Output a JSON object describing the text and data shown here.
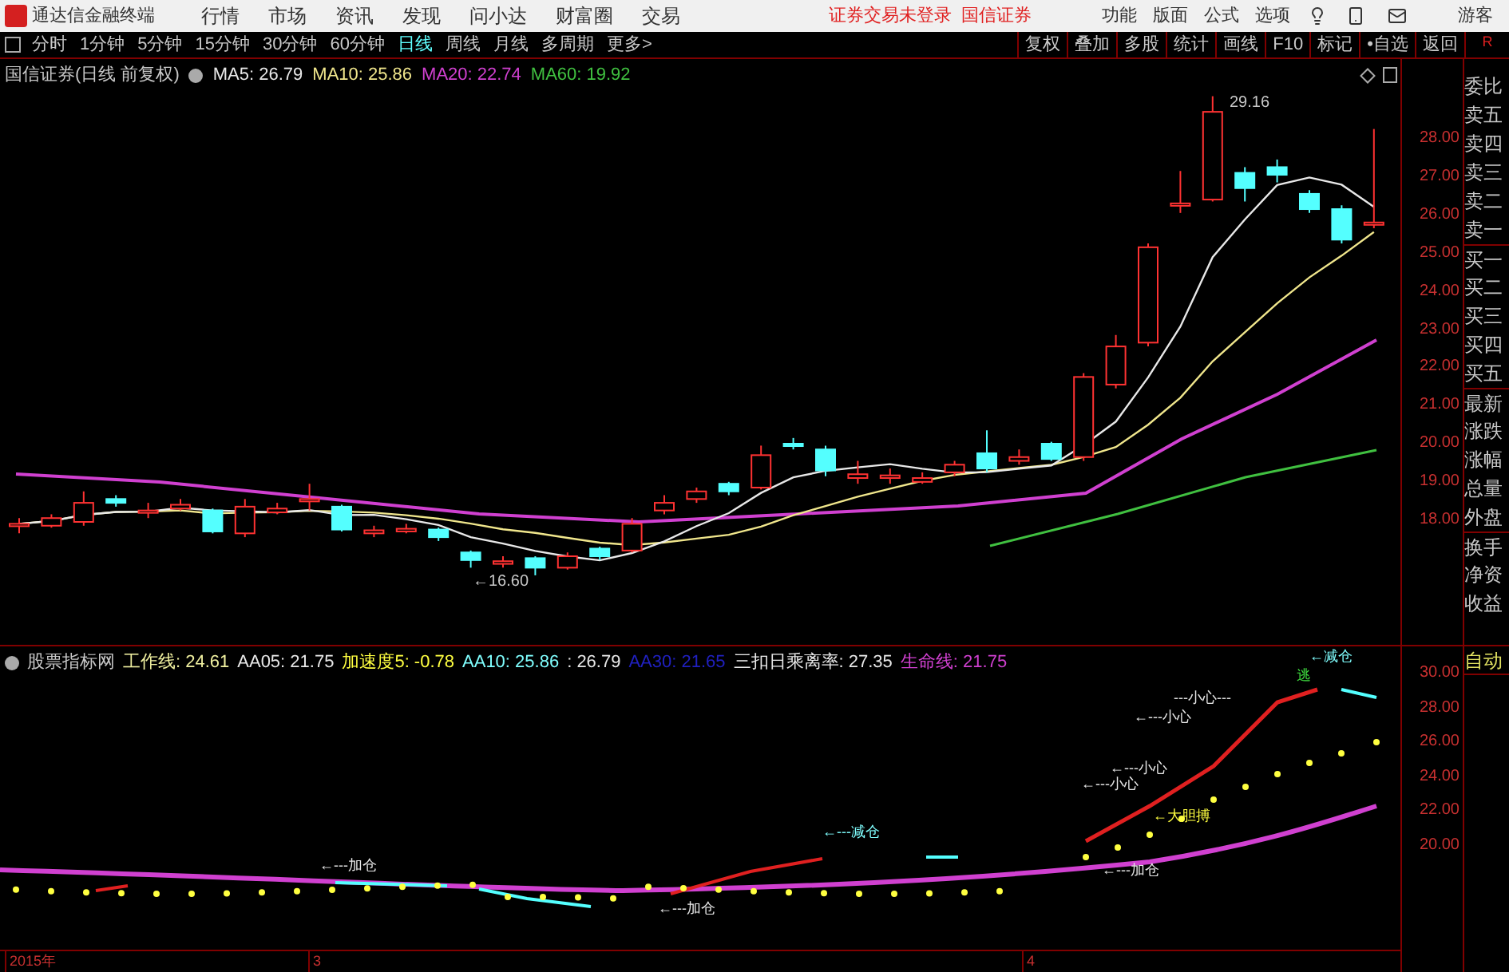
{
  "title_bar": {
    "app_name": "通达信金融终端",
    "menus": [
      "行情",
      "市场",
      "资讯",
      "发现",
      "问小达",
      "财富圈",
      "交易"
    ],
    "status_texts": [
      "证券交易未登录",
      "国信证券"
    ],
    "tools": [
      "功能",
      "版面",
      "公式",
      "选项"
    ],
    "user": "游客"
  },
  "period_bar": {
    "periods": [
      {
        "label": "分时",
        "selected": false
      },
      {
        "label": "1分钟",
        "selected": false
      },
      {
        "label": "5分钟",
        "selected": false
      },
      {
        "label": "15分钟",
        "selected": false
      },
      {
        "label": "30分钟",
        "selected": false
      },
      {
        "label": "60分钟",
        "selected": false
      },
      {
        "label": "日线",
        "selected": true
      },
      {
        "label": "周线",
        "selected": false
      },
      {
        "label": "月线",
        "selected": false
      },
      {
        "label": "多周期",
        "selected": false
      },
      {
        "label": "更多>",
        "selected": false
      }
    ],
    "actions": [
      "复权",
      "叠加",
      "多股",
      "统计",
      "画线",
      "F10",
      "标记",
      "•自选",
      "返回"
    ],
    "corner": "R"
  },
  "main_chart": {
    "title": "国信证券(日线 前复权)",
    "ma": [
      {
        "label": "MA5: 26.79",
        "color": "#e8e8e8"
      },
      {
        "label": "MA10: 25.86",
        "color": "#f0e68c"
      },
      {
        "label": "MA20: 22.74",
        "color": "#d040d0"
      },
      {
        "label": "MA60: 19.92",
        "color": "#40c040"
      }
    ],
    "price_labels": [
      "28.00",
      "27.00",
      "26.00",
      "25.00",
      "24.00",
      "23.00",
      "22.00",
      "21.00",
      "20.00",
      "19.00",
      "18.00"
    ],
    "high_label": "29.16",
    "low_label": "←16.60"
  },
  "quote_panel": {
    "items": [
      "委比",
      "卖五",
      "卖四",
      "卖三",
      "卖二",
      "卖一",
      "买一",
      "买二",
      "买三",
      "买四",
      "买五",
      "最新",
      "涨跌",
      "涨幅",
      "总量",
      "外盘",
      "换手",
      "净资",
      "收益"
    ],
    "mode": "自动"
  },
  "indicator": {
    "name": "股票指标网",
    "series": [
      {
        "label": "工作线: 24.61",
        "color": "#f0f0a0"
      },
      {
        "label": "AA05: 21.75",
        "color": "#e8e8e8"
      },
      {
        "label": "加速度5: -0.78",
        "color": "#ffff40"
      },
      {
        "label": "AA10: 25.86",
        "color": "#80ffff"
      },
      {
        "label": ": 26.79",
        "color": "#e8e8e8"
      },
      {
        "label": "AA30: 21.65",
        "color": "#2020c0"
      },
      {
        "label": "三扣日乘离率: 27.35",
        "color": "#e8e8e8"
      },
      {
        "label": "生命线: 21.75",
        "color": "#d040d0"
      }
    ],
    "axis_labels": [
      "30.00",
      "28.00",
      "26.00",
      "24.00",
      "22.00",
      "20.00"
    ],
    "annotations": [
      {
        "text": "←---减仓",
        "color": "#80ffff"
      },
      {
        "text": "---小心---",
        "color": "#e8e8e8"
      },
      {
        "text": "逃",
        "color": "#40e040"
      },
      {
        "text": "←减仓",
        "color": "#80ffff"
      },
      {
        "text": "←---小心",
        "color": "#e8e8e8"
      },
      {
        "text": "←---小心",
        "color": "#e8e8e8"
      },
      {
        "text": "←---小心",
        "color": "#e8e8e8"
      },
      {
        "text": "←大胆搏",
        "color": "#ffff40"
      },
      {
        "text": "←---加仓",
        "color": "#e8e8e8"
      },
      {
        "text": "←---加仓",
        "color": "#e8e8e8"
      },
      {
        "text": "←---加仓",
        "color": "#e8e8e8"
      }
    ]
  },
  "date_axis": [
    "2015年",
    "3",
    "4"
  ]
}
